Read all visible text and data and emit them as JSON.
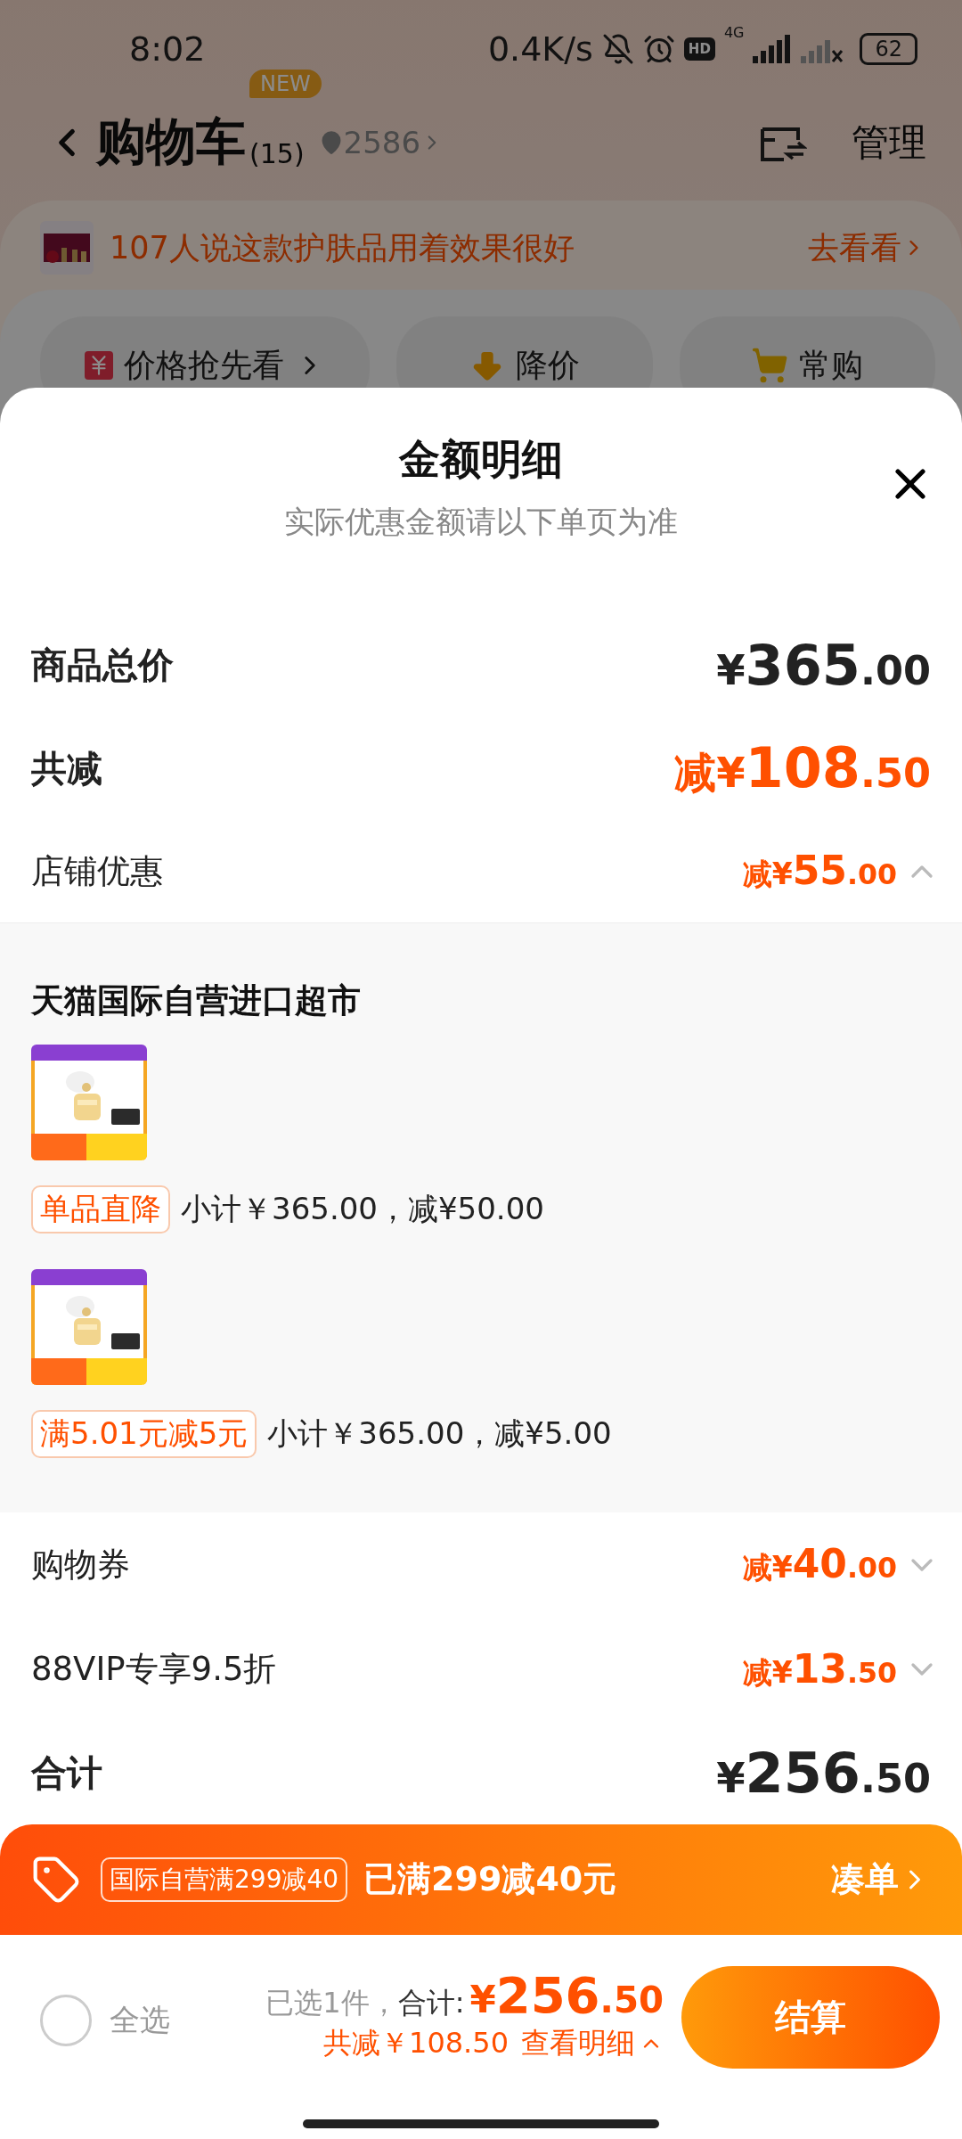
{
  "status_bar": {
    "time": "8:02",
    "network_speed": "0.4K/s",
    "hd_badge": "HD",
    "network_type": "4G",
    "battery": "62"
  },
  "header": {
    "title": "购物车",
    "badge": "NEW",
    "count": "(15)",
    "location": "2586",
    "action": "管理"
  },
  "banner": {
    "text": "107人说这款护肤品用着效果很好",
    "link": "去看看"
  },
  "quick_actions": [
    {
      "label": "价格抢先看",
      "kind": "price"
    },
    {
      "label": "降价",
      "kind": "drop"
    },
    {
      "label": "常购",
      "kind": "frequent"
    }
  ],
  "sheet": {
    "title": "金额明细",
    "subtitle": "实际优惠金额请以下单页为准",
    "rows": [
      {
        "kind": "headline",
        "label": "商品总价",
        "highlighted": false,
        "prefix": "¥",
        "integer": "365",
        "decimal": ".00"
      },
      {
        "kind": "headline",
        "label": "共减",
        "highlighted": true,
        "prefix": "减¥",
        "integer": "108",
        "decimal": ".50"
      },
      {
        "kind": "expandable",
        "label": "店铺优惠",
        "highlighted": true,
        "prefix": "减¥",
        "integer": "55",
        "decimal": ".00",
        "expanded": true,
        "store": {
          "name": "天猫国际自营进口超市",
          "items": [
            {
              "kind": "picture",
              "tag": "单品直降",
              "detail": "小计￥365.00，减¥50.00"
            },
            {
              "kind": "picture",
              "tag": "满5.01元减5元",
              "detail": "小计￥365.00，减¥5.00"
            }
          ]
        }
      },
      {
        "kind": "expandable",
        "label": "购物券",
        "highlighted": true,
        "prefix": "减¥",
        "integer": "40",
        "decimal": ".00",
        "expanded": false
      },
      {
        "kind": "expandable",
        "label": "88VIP专享9.5折",
        "highlighted": true,
        "prefix": "减¥",
        "integer": "13",
        "decimal": ".50",
        "expanded": false
      },
      {
        "kind": "headline",
        "label": "合计",
        "highlighted": false,
        "prefix": "¥",
        "integer": "256",
        "decimal": ".50"
      }
    ]
  },
  "promo_bar": {
    "tag": "国际自营满299减40",
    "text": "已满299减40元",
    "link": "凑单"
  },
  "bottom_bar": {
    "select_all": {
      "label": "全选",
      "checked": false
    },
    "selected_count": "已选1件，",
    "total_label": "合计:",
    "total": {
      "prefix": "¥",
      "integer": "256",
      "decimal": ".50"
    },
    "savings": "共减￥108.50",
    "detail_link": "查看明细",
    "checkout": "结算"
  }
}
